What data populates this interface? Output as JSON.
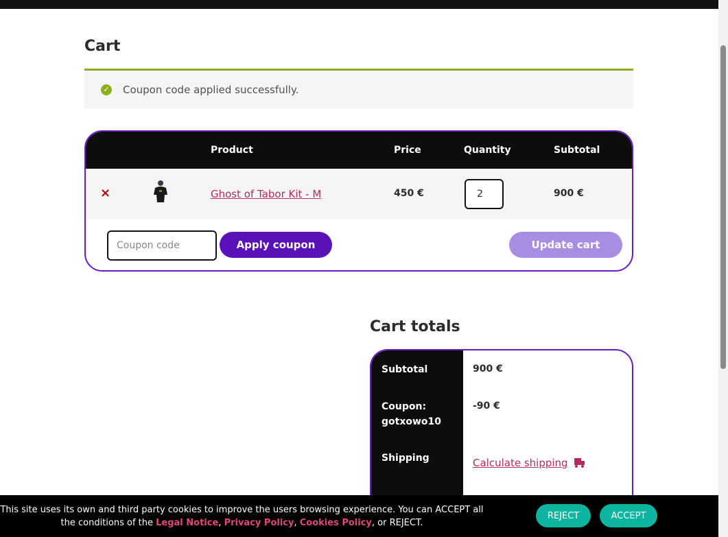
{
  "page": {
    "title": "Cart"
  },
  "notice": {
    "message": "Coupon code applied successfully.",
    "icon": "check-circle-icon",
    "accent": "#8fae1b"
  },
  "cart": {
    "headers": {
      "product": "Product",
      "price": "Price",
      "quantity": "Quantity",
      "subtotal": "Subtotal"
    },
    "items": [
      {
        "remove": "×",
        "name": "Ghost of Tabor Kit - M",
        "price": "450 €",
        "quantity": "2",
        "subtotal": "900 €"
      }
    ],
    "coupon_placeholder": "Coupon code",
    "apply_label": "Apply coupon",
    "update_label": "Update cart"
  },
  "totals": {
    "title": "Cart totals",
    "subtotal_label": "Subtotal",
    "subtotal_value": "900 €",
    "coupon_label": "Coupon: gotxowo10",
    "coupon_value": "-90 €",
    "shipping_label": "Shipping",
    "shipping_link": "Calculate shipping"
  },
  "cookies": {
    "text_before": "This site uses its own and third party cookies to improve the users browsing experience. You can ACCEPT all the conditions of the ",
    "legal": "Legal Notice",
    "sep1": ", ",
    "privacy": "Privacy Policy",
    "sep2": ", ",
    "cookies_policy": "Cookies Policy",
    "text_after": ", or REJECT.",
    "reject_label": "REJECT",
    "accept_label": "ACCEPT"
  },
  "colors": {
    "brand_purple": "#5a12b8",
    "border_purple": "#6a1bc8",
    "link_pink": "#b5295f",
    "teal": "#0db5a0"
  }
}
